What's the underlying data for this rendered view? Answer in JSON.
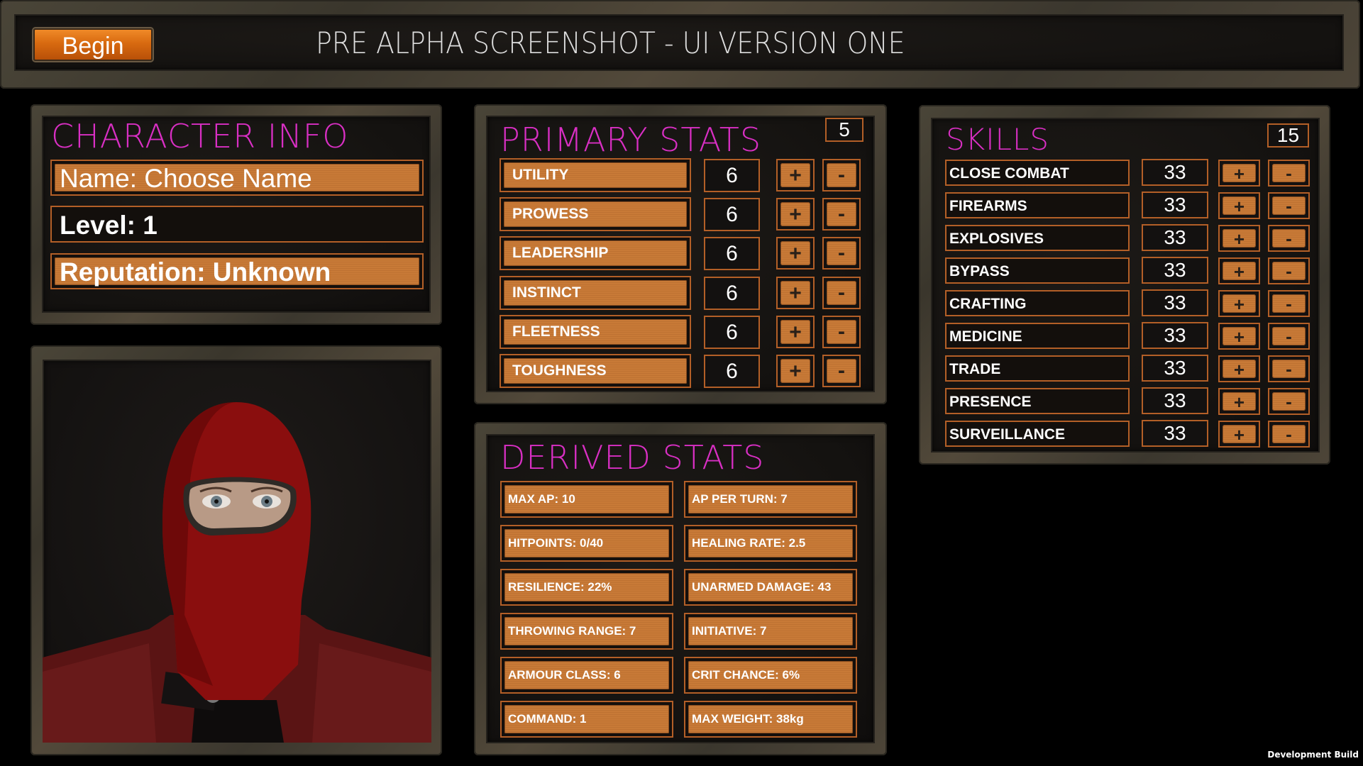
{
  "header": {
    "begin_label": "Begin",
    "title": "PRE ALPHA SCREENSHOT - UI VERSION ONE"
  },
  "character_info": {
    "title": "CHARACTER INFO",
    "name": "Name: Choose Name",
    "level": "Level: 1",
    "reputation": "Reputation: Unknown"
  },
  "portrait": {
    "description": "character portrait - red balaclava, red leather jacket"
  },
  "primary_stats": {
    "title": "PRIMARY STATS",
    "points_remaining": "5",
    "plus_label": "+",
    "minus_label": "-",
    "items": [
      {
        "label": "UTILITY",
        "value": "6"
      },
      {
        "label": "PROWESS",
        "value": "6"
      },
      {
        "label": "LEADERSHIP",
        "value": "6"
      },
      {
        "label": "INSTINCT",
        "value": "6"
      },
      {
        "label": "FLEETNESS",
        "value": "6"
      },
      {
        "label": "TOUGHNESS",
        "value": "6"
      }
    ]
  },
  "derived_stats": {
    "title": "DERIVED STATS",
    "items": [
      "MAX AP: 10",
      "AP PER TURN: 7",
      "HITPOINTS: 0/40",
      "HEALING RATE: 2.5",
      "RESILIENCE: 22%",
      "UNARMED DAMAGE: 43",
      "THROWING RANGE: 7",
      "INITIATIVE: 7",
      "ARMOUR CLASS: 6",
      "CRIT CHANCE: 6%",
      "COMMAND: 1",
      "MAX WEIGHT: 38kg"
    ]
  },
  "skills": {
    "title": "SKILLS",
    "points_remaining": "15",
    "plus_label": "+",
    "minus_label": "-",
    "items": [
      {
        "label": "CLOSE COMBAT",
        "value": "33"
      },
      {
        "label": "FIREARMS",
        "value": "33"
      },
      {
        "label": "EXPLOSIVES",
        "value": "33"
      },
      {
        "label": "BYPASS",
        "value": "33"
      },
      {
        "label": "CRAFTING",
        "value": "33"
      },
      {
        "label": "MEDICINE",
        "value": "33"
      },
      {
        "label": "TRADE",
        "value": "33"
      },
      {
        "label": "PRESENCE",
        "value": "33"
      },
      {
        "label": "SURVEILLANCE",
        "value": "33"
      }
    ]
  },
  "footer": {
    "build_label": "Development Build"
  },
  "colors": {
    "accent_orange": "#c87a37",
    "title_magenta": "#d92fc4",
    "border_orange": "#b35f27"
  }
}
